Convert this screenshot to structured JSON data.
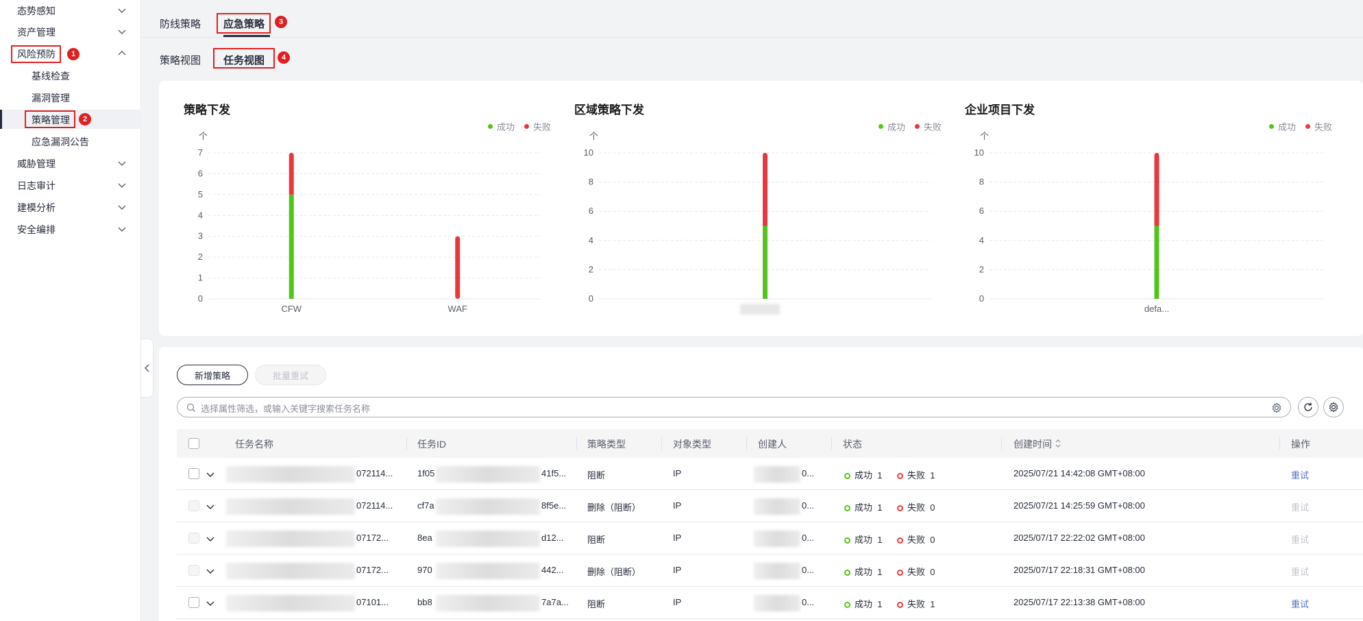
{
  "sidebar": {
    "items": [
      {
        "label": "态势感知"
      },
      {
        "label": "资产管理"
      },
      {
        "label": "风险预防"
      },
      {
        "label": "基线检查"
      },
      {
        "label": "漏洞管理"
      },
      {
        "label": "策略管理"
      },
      {
        "label": "应急漏洞公告"
      },
      {
        "label": "威胁管理"
      },
      {
        "label": "日志审计"
      },
      {
        "label": "建模分析"
      },
      {
        "label": "安全编排"
      }
    ]
  },
  "annotations": [
    "1",
    "2",
    "3",
    "4"
  ],
  "tabs": {
    "primary": [
      "防线策略",
      "应急策略"
    ],
    "secondary": [
      "策略视图",
      "任务视图"
    ]
  },
  "legend": {
    "success": "成功",
    "fail": "失败"
  },
  "colors": {
    "success": "#52c41a",
    "fail": "#e8383d",
    "link": "#526ecc"
  },
  "chart_data": [
    {
      "type": "bar",
      "title": "策略下发",
      "unit": "个",
      "categories": [
        "CFW",
        "WAF"
      ],
      "series": [
        {
          "name": "成功",
          "values": [
            5,
            0
          ]
        },
        {
          "name": "失败",
          "values": [
            2,
            3
          ]
        }
      ],
      "stacked": true,
      "ylim": [
        0,
        7
      ],
      "yticks": [
        0,
        1,
        2,
        3,
        4,
        5,
        6,
        7
      ],
      "legend_position": "top-right"
    },
    {
      "type": "bar",
      "title": "区域策略下发",
      "unit": "个",
      "categories": [
        ""
      ],
      "series": [
        {
          "name": "成功",
          "values": [
            5
          ]
        },
        {
          "name": "失败",
          "values": [
            5
          ]
        }
      ],
      "stacked": true,
      "ylim": [
        0,
        10
      ],
      "yticks": [
        0,
        2,
        4,
        6,
        8,
        10
      ],
      "legend_position": "top-right"
    },
    {
      "type": "bar",
      "title": "企业项目下发",
      "unit": "个",
      "categories": [
        "defa..."
      ],
      "series": [
        {
          "name": "成功",
          "values": [
            5
          ]
        },
        {
          "name": "失败",
          "values": [
            5
          ]
        }
      ],
      "stacked": true,
      "ylim": [
        0,
        10
      ],
      "yticks": [
        0,
        2,
        4,
        6,
        8,
        10
      ],
      "legend_position": "top-right"
    }
  ],
  "toolbar": {
    "new_label": "新增策略",
    "batch_retry_label": "批量重试",
    "search_placeholder": "选择属性筛选，或输入关键字搜索任务名称"
  },
  "table": {
    "columns": [
      "任务名称",
      "任务ID",
      "策略类型",
      "对象类型",
      "创建人",
      "状态",
      "创建时间",
      "操作"
    ],
    "rows": [
      {
        "name_suffix": "072114...",
        "id_prefix": "1f05",
        "id_suffix": "41f5...",
        "policy_type": "阻断",
        "object_type": "IP",
        "creator_suffix": "0...",
        "success_label": "成功",
        "success_count": "1",
        "fail_label": "失败",
        "fail_count": "1",
        "created": "2025/07/21 14:42:08 GMT+08:00",
        "action": "重试",
        "action_enabled": true
      },
      {
        "name_suffix": "072114...",
        "id_prefix": "cf7a",
        "id_suffix": "8f5e...",
        "policy_type": "删除（阻断）",
        "object_type": "IP",
        "creator_suffix": "0...",
        "success_label": "成功",
        "success_count": "1",
        "fail_label": "失败",
        "fail_count": "0",
        "created": "2025/07/21 14:25:59 GMT+08:00",
        "action": "重试",
        "action_enabled": false
      },
      {
        "name_suffix": "07172...",
        "id_prefix": "8ea",
        "id_suffix": "d12...",
        "policy_type": "阻断",
        "object_type": "IP",
        "creator_suffix": "0...",
        "success_label": "成功",
        "success_count": "1",
        "fail_label": "失败",
        "fail_count": "0",
        "created": "2025/07/17 22:22:02 GMT+08:00",
        "action": "重试",
        "action_enabled": false
      },
      {
        "name_suffix": "07172...",
        "id_prefix": "970",
        "id_suffix": "442...",
        "policy_type": "删除（阻断）",
        "object_type": "IP",
        "creator_suffix": "0...",
        "success_label": "成功",
        "success_count": "1",
        "fail_label": "失败",
        "fail_count": "0",
        "created": "2025/07/17 22:18:31 GMT+08:00",
        "action": "重试",
        "action_enabled": false
      },
      {
        "name_suffix": "07101...",
        "id_prefix": "bb8",
        "id_suffix": "7a7a...",
        "policy_type": "阻断",
        "object_type": "IP",
        "creator_suffix": "0...",
        "success_label": "成功",
        "success_count": "1",
        "fail_label": "失败",
        "fail_count": "1",
        "created": "2025/07/17 22:13:38 GMT+08:00",
        "action": "重试",
        "action_enabled": true
      }
    ]
  }
}
